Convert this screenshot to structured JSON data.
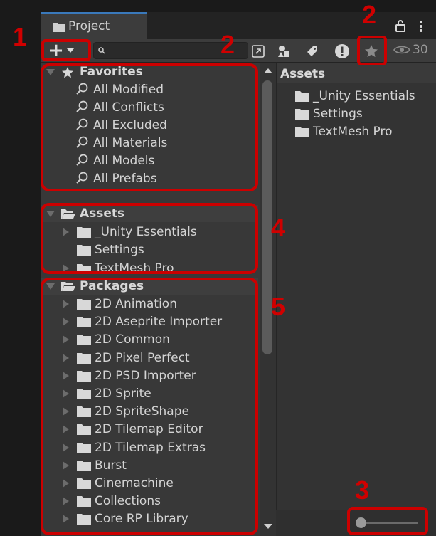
{
  "tab": {
    "title": "Project"
  },
  "toolbar": {
    "create_symbol": "+",
    "search_placeholder": "",
    "visibility_count": "30"
  },
  "favorites": {
    "header": "Favorites",
    "items": [
      "All Modified",
      "All Conflicts",
      "All Excluded",
      "All Materials",
      "All Models",
      "All Prefabs"
    ]
  },
  "assets_tree": {
    "header": "Assets",
    "items": [
      "_Unity Essentials",
      "Settings",
      "TextMesh Pro"
    ]
  },
  "packages": {
    "header": "Packages",
    "items": [
      "2D Animation",
      "2D Aseprite Importer",
      "2D Common",
      "2D Pixel Perfect",
      "2D PSD Importer",
      "2D Sprite",
      "2D SpriteShape",
      "2D Tilemap Editor",
      "2D Tilemap Extras",
      "Burst",
      "Cinemachine",
      "Collections",
      "Core RP Library"
    ]
  },
  "right_pane": {
    "header": "Assets",
    "items": [
      "_Unity Essentials",
      "Settings",
      "TextMesh Pro"
    ]
  },
  "annotations": {
    "n1": "1",
    "n2a": "2",
    "n2b": "2",
    "n3": "3",
    "n4": "4",
    "n5": "5"
  },
  "colors": {
    "highlight": "#cc0000",
    "tab_accent": "#3a79bb",
    "panel_bg": "#383838"
  },
  "icons": [
    "folder-icon",
    "lock-icon",
    "kebab-menu-icon",
    "search-icon",
    "link-icon",
    "type-filter-icon",
    "label-icon",
    "warning-icon",
    "star-icon",
    "eye-icon"
  ]
}
